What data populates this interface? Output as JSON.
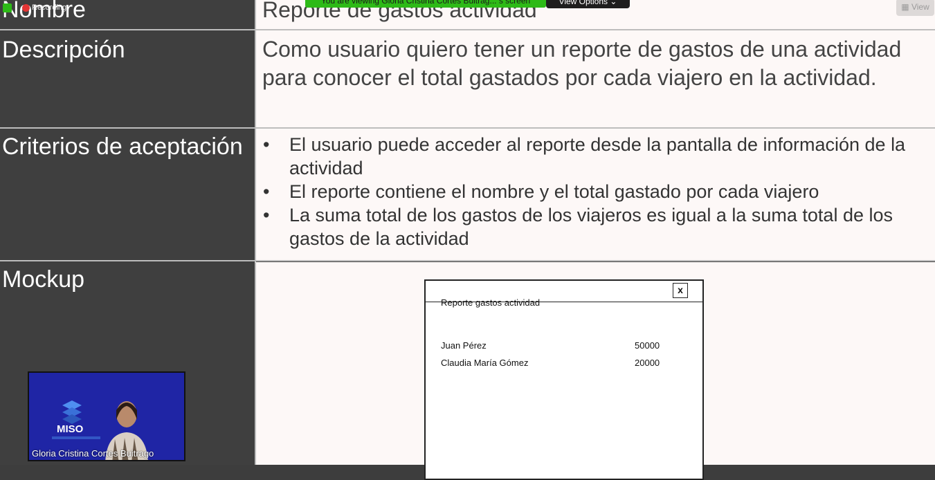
{
  "table": {
    "name": {
      "label": "Nombre",
      "value": "Reporte de gastos actividad"
    },
    "description": {
      "label": "Descripción",
      "value": "Como usuario quiero tener un reporte de gastos de una actividad para conocer el total gastados por cada viajero en la actividad."
    },
    "criteria": {
      "label": "Criterios de aceptación",
      "items": [
        "El usuario puede acceder al reporte desde la pantalla de información de la actividad",
        "El reporte contiene el nombre y el total gastado por cada viajero",
        "La suma total de los gastos de los viajeros es igual a la suma total de los gastos de la actividad"
      ]
    },
    "mockup": {
      "label": "Mockup"
    }
  },
  "mockup_window": {
    "title": "Reporte gastos actividad",
    "close_label": "x",
    "rows": [
      {
        "name": "Juan Pérez",
        "amount": "50000"
      },
      {
        "name": "Claudia María Gómez",
        "amount": "20000"
      }
    ]
  },
  "overlay": {
    "recording_label": "Recording",
    "banner_text": "You are viewing Gloria Cristina Cortes Buitrag... s screen",
    "view_options_label": "View Options",
    "view_button_label": "View"
  },
  "video": {
    "speaker_name": "Gloria Cristina Cortes Buitrago",
    "logo_text": "MISO"
  },
  "colors": {
    "label_bg": "#3f3f3f",
    "value_bg": "#fdf8f7",
    "banner_green": "#2dba17",
    "video_bg": "#1f25a5"
  }
}
